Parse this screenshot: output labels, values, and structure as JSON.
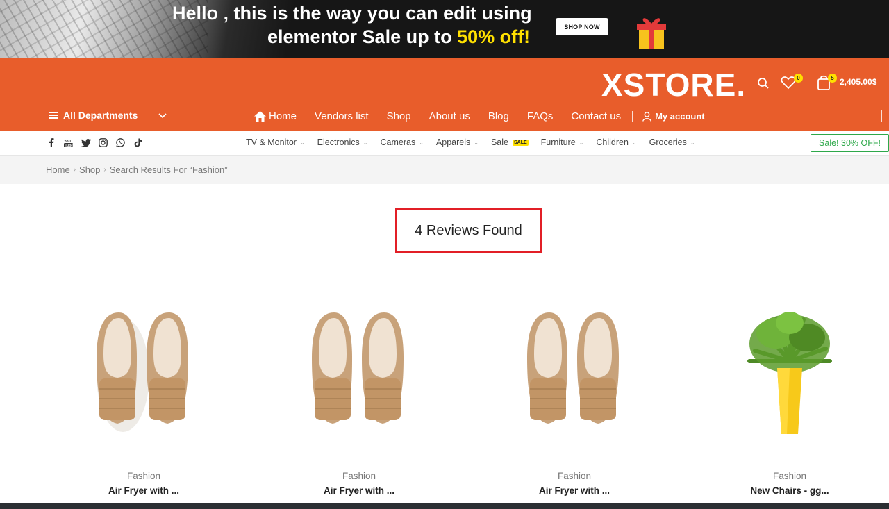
{
  "banner": {
    "line1": "Hello , this is the way you can edit using",
    "line2_prefix": "elementor Sale up to ",
    "line2_highlight": "50% off!",
    "shop_now": "SHOP NOW",
    "highlight_color": "#ffe000"
  },
  "header": {
    "logo": "XSTORE.",
    "brand_color": "#e85d2b",
    "wishlist_count": "0",
    "cart_count": "5",
    "cart_total": "2,405.00$",
    "departments_label": "All Departments",
    "nav": [
      "Home",
      "Vendors list",
      "Shop",
      "About us",
      "Blog",
      "FAQs",
      "Contact us"
    ],
    "account_label": "My account"
  },
  "catbar": {
    "social_icons": [
      "facebook-icon",
      "youtube-icon",
      "twitter-icon",
      "instagram-icon",
      "whatsapp-icon",
      "tiktok-icon"
    ],
    "categories": [
      "TV & Monitor",
      "Electronics",
      "Cameras",
      "Apparels",
      "Sale",
      "Furniture",
      "Children",
      "Groceries"
    ],
    "sale_tag": "SALE",
    "sale_button": "Sale! 30% OFF!",
    "sale_button_color": "#2ea84a"
  },
  "breadcrumb": [
    "Home",
    "Shop",
    "Search Results For “Fashion”"
  ],
  "results": {
    "heading": "4 Reviews Found",
    "highlight_border_color": "#e21f26"
  },
  "products": [
    {
      "category": "Fashion",
      "title": "Air Fryer with ...",
      "image": "shoes"
    },
    {
      "category": "Fashion",
      "title": "Air Fryer with ...",
      "image": "shoes"
    },
    {
      "category": "Fashion",
      "title": "Air Fryer with ...",
      "image": "shoes"
    },
    {
      "category": "Fashion",
      "title": "New Chairs - gg...",
      "image": "potted-plant"
    }
  ]
}
